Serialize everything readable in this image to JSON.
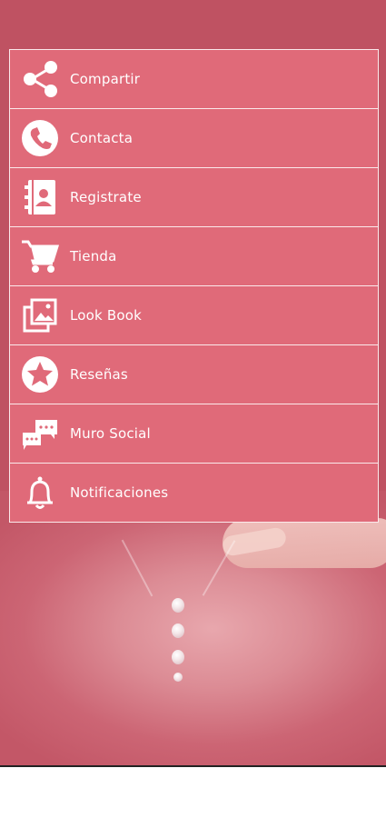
{
  "menu": {
    "items": [
      {
        "id": "compartir",
        "label": "Compartir",
        "icon": "share-icon"
      },
      {
        "id": "contacta",
        "label": "Contacta",
        "icon": "phone-icon"
      },
      {
        "id": "registrate",
        "label": "Registrate",
        "icon": "address-book-icon"
      },
      {
        "id": "tienda",
        "label": "Tienda",
        "icon": "shopping-cart-icon"
      },
      {
        "id": "look-book",
        "label": "Look Book",
        "icon": "photo-gallery-icon"
      },
      {
        "id": "resenas",
        "label": "Reseñas",
        "icon": "star-icon"
      },
      {
        "id": "muro-social",
        "label": "Muro Social",
        "icon": "chat-bubbles-icon"
      },
      {
        "id": "notificaciones",
        "label": "Notificaciones",
        "icon": "bell-icon"
      }
    ]
  },
  "colors": {
    "menu_background": "#e06a79",
    "app_background": "#c25664",
    "menu_text": "#ffffff"
  }
}
